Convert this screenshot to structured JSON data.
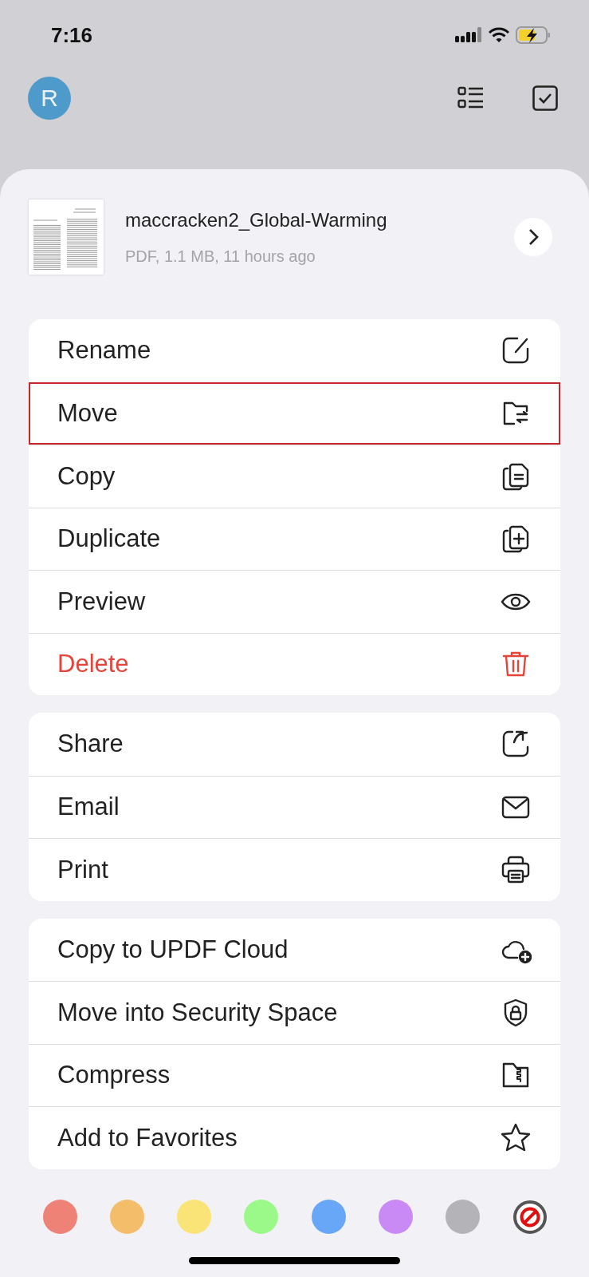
{
  "status_bar": {
    "time": "7:16"
  },
  "header": {
    "avatar_letter": "R"
  },
  "file": {
    "name": "maccracken2_Global-Warming",
    "details": "PDF, 1.1 MB, 11 hours ago"
  },
  "menu_groups": [
    {
      "items": [
        {
          "label": "Rename",
          "highlighted": false,
          "destructive": false
        },
        {
          "label": "Move",
          "highlighted": true,
          "destructive": false
        },
        {
          "label": "Copy",
          "highlighted": false,
          "destructive": false
        },
        {
          "label": "Duplicate",
          "highlighted": false,
          "destructive": false
        },
        {
          "label": "Preview",
          "highlighted": false,
          "destructive": false
        },
        {
          "label": "Delete",
          "highlighted": false,
          "destructive": true
        }
      ]
    },
    {
      "items": [
        {
          "label": "Share",
          "highlighted": false,
          "destructive": false
        },
        {
          "label": "Email",
          "highlighted": false,
          "destructive": false
        },
        {
          "label": "Print",
          "highlighted": false,
          "destructive": false
        }
      ]
    },
    {
      "items": [
        {
          "label": "Copy to UPDF Cloud",
          "highlighted": false,
          "destructive": false
        },
        {
          "label": "Move into Security Space",
          "highlighted": false,
          "destructive": false
        },
        {
          "label": "Compress",
          "highlighted": false,
          "destructive": false
        },
        {
          "label": "Add to Favorites",
          "highlighted": false,
          "destructive": false
        }
      ]
    }
  ],
  "tags": [
    {
      "color": "#ee8276"
    },
    {
      "color": "#f3bd6a"
    },
    {
      "color": "#fbe477"
    },
    {
      "color": "#9bf98a"
    },
    {
      "color": "#68a6f8"
    },
    {
      "color": "#c98af5"
    },
    {
      "color": "#b4b3b8"
    }
  ]
}
